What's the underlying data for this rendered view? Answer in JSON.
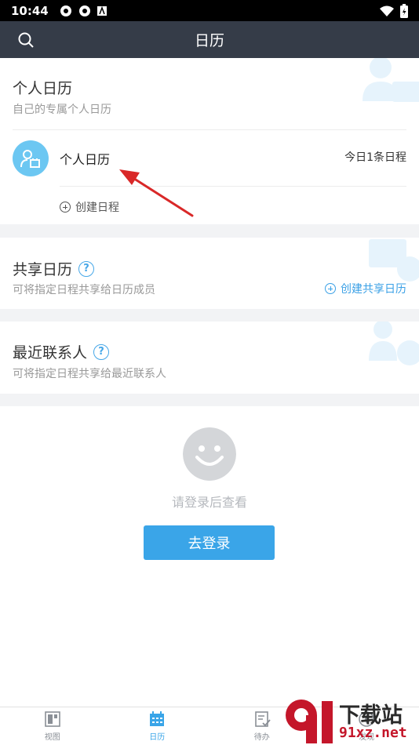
{
  "status": {
    "time": "10:44"
  },
  "header": {
    "title": "日历"
  },
  "personal": {
    "title": "个人日历",
    "subtitle": "自己的专属个人日历",
    "item_name": "个人日历",
    "today_count": "今日1条日程",
    "create_label": "创建日程"
  },
  "shared": {
    "title": "共享日历",
    "subtitle": "可将指定日程共享给日历成员",
    "create_label": "创建共享日历"
  },
  "recent": {
    "title": "最近联系人",
    "subtitle": "可将指定日程共享给最近联系人"
  },
  "help_mark": "?",
  "empty": {
    "message": "请登录后查看",
    "login_label": "去登录"
  },
  "tabs": [
    {
      "label": "视图",
      "icon": "view-icon"
    },
    {
      "label": "日历",
      "icon": "calendar-icon",
      "active": true
    },
    {
      "label": "待办",
      "icon": "todo-icon"
    },
    {
      "label": "发现",
      "icon": "discover-icon"
    }
  ],
  "watermark": {
    "line1": "下载站",
    "line2": "91xz.net"
  },
  "colors": {
    "header": "#353c48",
    "accent": "#3aa5e8",
    "avatar": "#6cc7f2",
    "arrow": "#d92828"
  }
}
